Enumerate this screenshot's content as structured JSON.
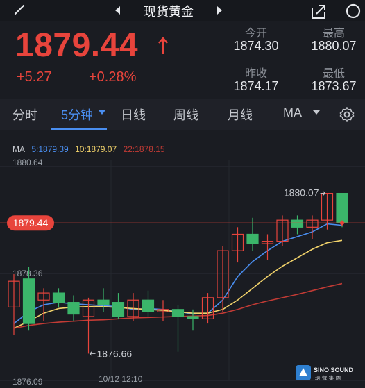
{
  "header": {
    "title": "现货黄金"
  },
  "quote": {
    "price": "1879.44",
    "change": "+5.27",
    "change_pct": "+0.28%",
    "open_label": "今开",
    "open_value": "1874.30",
    "high_label": "最高",
    "high_value": "1880.07",
    "prev_close_label": "昨收",
    "prev_close_value": "1874.17",
    "low_label": "最低",
    "low_value": "1873.67"
  },
  "tabs": {
    "items": [
      {
        "label": "分时"
      },
      {
        "label": "5分钟"
      },
      {
        "label": "日线"
      },
      {
        "label": "周线"
      },
      {
        "label": "月线"
      },
      {
        "label": "MA"
      }
    ],
    "active_index": 1
  },
  "ma_legend": {
    "ma_label": "MA",
    "ma5": "5:1879.39",
    "ma10": "10:1879.07",
    "ma22": "22:1878.15"
  },
  "colors": {
    "up": "#e8443c",
    "down": "#3bb56a",
    "ma5": "#4a8ef0",
    "ma10": "#f2d36b",
    "ma22": "#c23b35",
    "accent": "#4a8ef0",
    "background": "#1a1c22"
  },
  "watermark": {
    "brand": "SINO SOUND",
    "sub": "環 聲 集 團"
  },
  "chart_data": {
    "type": "candlestick",
    "ylim": [
      1876.09,
      1880.64
    ],
    "y_ticks": [
      "1880.64",
      "1878.36",
      "1876.09"
    ],
    "x_tick": "10/12 12:10",
    "current_price_label": "1879.44",
    "current_price": 1879.44,
    "max_annotation": "1880.07",
    "max_value": 1880.07,
    "min_annotation": "1876.66",
    "min_value": 1876.66,
    "candles": [
      {
        "o": 1877.65,
        "h": 1878.35,
        "l": 1877.05,
        "c": 1878.2
      },
      {
        "o": 1878.25,
        "h": 1878.5,
        "l": 1877.15,
        "c": 1877.3
      },
      {
        "o": 1877.8,
        "h": 1878.05,
        "l": 1877.35,
        "c": 1877.95
      },
      {
        "o": 1877.95,
        "h": 1878.05,
        "l": 1877.65,
        "c": 1877.75
      },
      {
        "o": 1877.75,
        "h": 1877.9,
        "l": 1877.35,
        "c": 1877.5
      },
      {
        "o": 1877.45,
        "h": 1877.85,
        "l": 1876.66,
        "c": 1877.8
      },
      {
        "o": 1877.8,
        "h": 1878.05,
        "l": 1877.55,
        "c": 1877.7
      },
      {
        "o": 1877.75,
        "h": 1877.95,
        "l": 1877.4,
        "c": 1877.45
      },
      {
        "o": 1877.45,
        "h": 1877.95,
        "l": 1877.35,
        "c": 1877.8
      },
      {
        "o": 1877.8,
        "h": 1878.0,
        "l": 1877.45,
        "c": 1877.55
      },
      {
        "o": 1877.55,
        "h": 1877.8,
        "l": 1877.35,
        "c": 1877.6
      },
      {
        "o": 1877.6,
        "h": 1877.7,
        "l": 1876.7,
        "c": 1877.45
      },
      {
        "o": 1877.45,
        "h": 1877.6,
        "l": 1877.15,
        "c": 1877.4
      },
      {
        "o": 1877.4,
        "h": 1877.95,
        "l": 1877.3,
        "c": 1877.85
      },
      {
        "o": 1877.85,
        "h": 1878.95,
        "l": 1877.55,
        "c": 1878.85
      },
      {
        "o": 1878.85,
        "h": 1879.35,
        "l": 1878.6,
        "c": 1879.2
      },
      {
        "o": 1879.2,
        "h": 1879.55,
        "l": 1878.85,
        "c": 1879.0
      },
      {
        "o": 1879.0,
        "h": 1879.2,
        "l": 1878.65,
        "c": 1879.05
      },
      {
        "o": 1879.05,
        "h": 1879.6,
        "l": 1878.95,
        "c": 1879.5
      },
      {
        "o": 1879.5,
        "h": 1879.6,
        "l": 1879.2,
        "c": 1879.35
      },
      {
        "o": 1879.35,
        "h": 1879.6,
        "l": 1879.1,
        "c": 1879.5
      },
      {
        "o": 1879.5,
        "h": 1880.07,
        "l": 1879.3,
        "c": 1880.07
      },
      {
        "o": 1880.07,
        "h": 1880.07,
        "l": 1879.35,
        "c": 1879.44
      }
    ],
    "series": [
      {
        "name": "MA5",
        "values": [
          1877.3,
          1877.55,
          1877.7,
          1877.75,
          1877.72,
          1877.7,
          1877.68,
          1877.66,
          1877.6,
          1877.62,
          1877.6,
          1877.56,
          1877.5,
          1877.52,
          1877.8,
          1878.3,
          1878.62,
          1878.85,
          1879.05,
          1879.15,
          1879.25,
          1879.42,
          1879.39
        ]
      },
      {
        "name": "MA10",
        "values": [
          1877.2,
          1877.35,
          1877.52,
          1877.62,
          1877.65,
          1877.66,
          1877.66,
          1877.64,
          1877.62,
          1877.6,
          1877.58,
          1877.55,
          1877.52,
          1877.52,
          1877.6,
          1877.8,
          1878.05,
          1878.3,
          1878.52,
          1878.7,
          1878.88,
          1879.02,
          1879.07
        ]
      },
      {
        "name": "MA22",
        "values": [
          1877.2,
          1877.26,
          1877.3,
          1877.33,
          1877.35,
          1877.37,
          1877.38,
          1877.4,
          1877.42,
          1877.43,
          1877.44,
          1877.45,
          1877.46,
          1877.47,
          1877.52,
          1877.6,
          1877.7,
          1877.78,
          1877.85,
          1877.92,
          1878.0,
          1878.08,
          1878.15
        ]
      }
    ]
  }
}
